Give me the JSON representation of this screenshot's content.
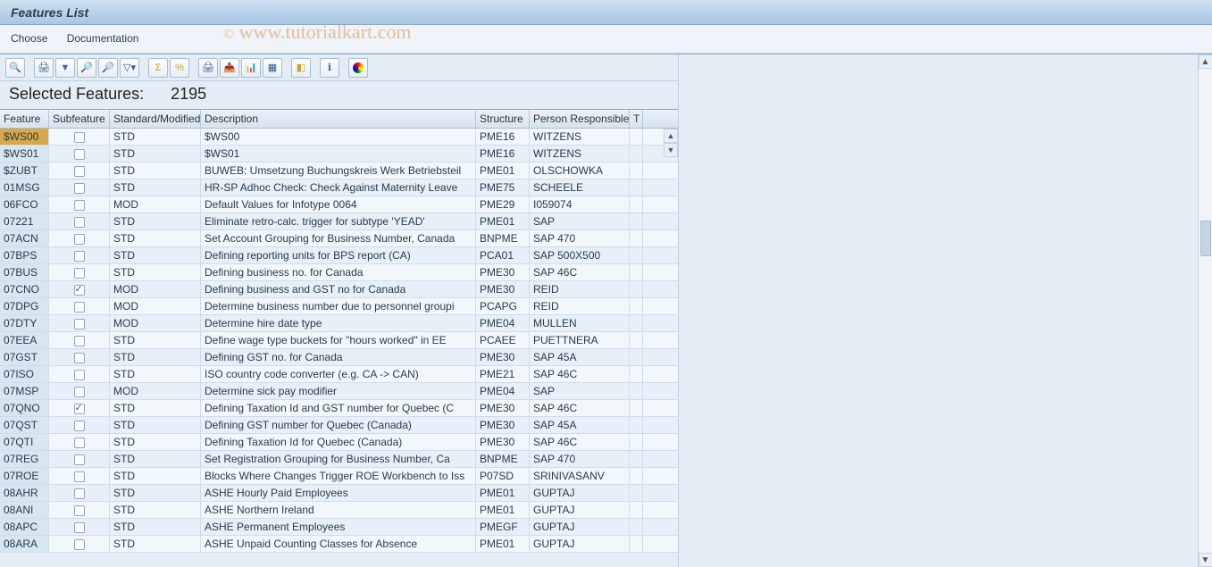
{
  "header": {
    "title": "Features List"
  },
  "menu": {
    "choose": "Choose",
    "documentation": "Documentation"
  },
  "watermark": {
    "copy": "©",
    "text": "www.tutorialkart.com"
  },
  "toolbar": {
    "icons": [
      {
        "name": "details-icon",
        "glyph": "🔍"
      },
      {
        "sep": true
      },
      {
        "name": "print-icon",
        "glyph": "🖨"
      },
      {
        "name": "filter-icon",
        "glyph": "▼",
        "cls": "ic-blue"
      },
      {
        "name": "find-icon",
        "glyph": "🔎",
        "cls": "ic-yellow"
      },
      {
        "name": "find-next-icon",
        "glyph": "🔎"
      },
      {
        "name": "set-filter-icon",
        "glyph": "▽▾"
      },
      {
        "sep": true
      },
      {
        "name": "sum-icon",
        "glyph": "Σ",
        "cls": "ic-yellow"
      },
      {
        "name": "subtotal-icon",
        "glyph": "%",
        "cls": "ic-yellow"
      },
      {
        "sep": true
      },
      {
        "name": "print2-icon",
        "glyph": "🖨"
      },
      {
        "name": "export-icon",
        "glyph": "📤",
        "cls": "ic-yellow"
      },
      {
        "name": "excel-icon",
        "glyph": "📊",
        "cls": "ic-green"
      },
      {
        "name": "layout-icon",
        "glyph": "▦"
      },
      {
        "sep": true
      },
      {
        "name": "selectall-icon",
        "glyph": "◧",
        "cls": "ic-yellow"
      },
      {
        "sep": true
      },
      {
        "name": "info-icon",
        "glyph": "ℹ",
        "cls": "ic-blue"
      },
      {
        "sep": true
      },
      {
        "name": "legend-icon",
        "glyph": "●",
        "cls": "multi"
      }
    ]
  },
  "count": {
    "label": "Selected Features:",
    "value": "2195"
  },
  "table": {
    "headers": {
      "feature": "Feature",
      "subfeature": "Subfeature",
      "stdmod": "Standard/Modified",
      "description": "Description",
      "structure": "Structure",
      "person": "Person Responsible",
      "t": "T"
    },
    "rows": [
      {
        "feature": "$WS00",
        "sub": false,
        "std": "STD",
        "desc": "$WS00",
        "struct": "PME16",
        "person": "WITZENS"
      },
      {
        "feature": "$WS01",
        "sub": false,
        "std": "STD",
        "desc": "$WS01",
        "struct": "PME16",
        "person": "WITZENS"
      },
      {
        "feature": "$ZUBT",
        "sub": false,
        "std": "STD",
        "desc": "BUWEB: Umsetzung Buchungskreis Werk Betriebsteil",
        "struct": "PME01",
        "person": "OLSCHOWKA"
      },
      {
        "feature": "01MSG",
        "sub": false,
        "std": "STD",
        "desc": "HR-SP Adhoc Check: Check Against Maternity Leave",
        "struct": "PME75",
        "person": "SCHEELE"
      },
      {
        "feature": "06FCO",
        "sub": false,
        "std": "MOD",
        "desc": "Default Values for Infotype 0064",
        "struct": "PME29",
        "person": "I059074"
      },
      {
        "feature": "07221",
        "sub": false,
        "std": "STD",
        "desc": "Eliminate retro-calc. trigger for subtype 'YEAD'",
        "struct": "PME01",
        "person": "SAP"
      },
      {
        "feature": "07ACN",
        "sub": false,
        "std": "STD",
        "desc": "Set Account Grouping for Business Number, Canada",
        "struct": "BNPME",
        "person": "SAP 470"
      },
      {
        "feature": "07BPS",
        "sub": false,
        "std": "STD",
        "desc": "Defining reporting units for BPS report (CA)",
        "struct": "PCA01",
        "person": "SAP 500X500"
      },
      {
        "feature": "07BUS",
        "sub": false,
        "std": "STD",
        "desc": "Defining business no. for Canada",
        "struct": "PME30",
        "person": "SAP 46C"
      },
      {
        "feature": "07CNO",
        "sub": true,
        "std": "MOD",
        "desc": "Defining business and GST no for Canada",
        "struct": "PME30",
        "person": "REID"
      },
      {
        "feature": "07DPG",
        "sub": false,
        "std": "MOD",
        "desc": "Determine business number due to personnel groupi",
        "struct": "PCAPG",
        "person": "REID"
      },
      {
        "feature": "07DTY",
        "sub": false,
        "std": "MOD",
        "desc": "Determine hire date type",
        "struct": "PME04",
        "person": "MULLEN"
      },
      {
        "feature": "07EEA",
        "sub": false,
        "std": "STD",
        "desc": "Define wage type buckets for \"hours worked\" in EE",
        "struct": "PCAEE",
        "person": "PUETTNERA"
      },
      {
        "feature": "07GST",
        "sub": false,
        "std": "STD",
        "desc": "Defining GST no. for Canada",
        "struct": "PME30",
        "person": "SAP 45A"
      },
      {
        "feature": "07ISO",
        "sub": false,
        "std": "STD",
        "desc": "ISO country code converter (e.g. CA -> CAN)",
        "struct": "PME21",
        "person": "SAP 46C"
      },
      {
        "feature": "07MSP",
        "sub": false,
        "std": "MOD",
        "desc": "Determine sick pay modifier",
        "struct": "PME04",
        "person": "SAP"
      },
      {
        "feature": "07QNO",
        "sub": true,
        "std": "STD",
        "desc": "Defining Taxation Id and GST number for Quebec (C",
        "struct": "PME30",
        "person": "SAP 46C"
      },
      {
        "feature": "07QST",
        "sub": false,
        "std": "STD",
        "desc": "Defining GST number for Quebec (Canada)",
        "struct": "PME30",
        "person": "SAP 45A"
      },
      {
        "feature": "07QTI",
        "sub": false,
        "std": "STD",
        "desc": "Defining Taxation Id  for Quebec (Canada)",
        "struct": "PME30",
        "person": "SAP 46C"
      },
      {
        "feature": "07REG",
        "sub": false,
        "std": "STD",
        "desc": "Set Registration Grouping for Business Number, Ca",
        "struct": "BNPME",
        "person": "SAP 470"
      },
      {
        "feature": "07ROE",
        "sub": false,
        "std": "STD",
        "desc": "Blocks Where Changes Trigger ROE Workbench to Iss",
        "struct": "P07SD",
        "person": "SRINIVASANV"
      },
      {
        "feature": "08AHR",
        "sub": false,
        "std": "STD",
        "desc": "ASHE Hourly Paid Employees",
        "struct": "PME01",
        "person": "GUPTAJ"
      },
      {
        "feature": "08ANI",
        "sub": false,
        "std": "STD",
        "desc": "ASHE Northern Ireland",
        "struct": "PME01",
        "person": "GUPTAJ"
      },
      {
        "feature": "08APC",
        "sub": false,
        "std": "STD",
        "desc": "ASHE Permanent Employees",
        "struct": "PMEGF",
        "person": "GUPTAJ"
      },
      {
        "feature": "08ARA",
        "sub": false,
        "std": "STD",
        "desc": "ASHE Unpaid Counting Classes for Absence",
        "struct": "PME01",
        "person": "GUPTAJ"
      }
    ]
  }
}
